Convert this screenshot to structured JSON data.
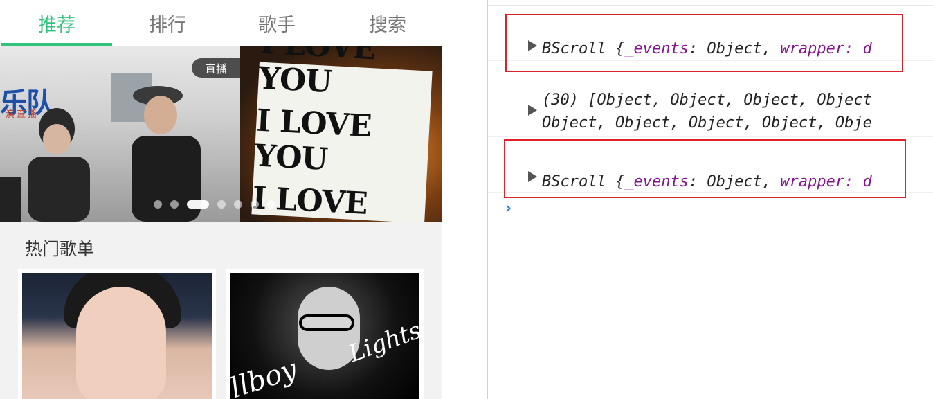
{
  "tabs": [
    {
      "label": "推荐",
      "active": true
    },
    {
      "label": "排行",
      "active": false
    },
    {
      "label": "歌手",
      "active": false
    },
    {
      "label": "搜索",
      "active": false
    }
  ],
  "slider": {
    "live_badge": "直播",
    "band_text": "乐队",
    "band_sub": "演直播",
    "sign_lines": [
      "I LOVE YOU",
      "I LOVE YOU",
      "I LOVE YOU"
    ],
    "dot_count": 7,
    "active_dot": 3
  },
  "section": {
    "title": "热门歌单"
  },
  "cards": [
    {
      "image": "portrait-woman"
    },
    {
      "image": "portrait-man-glasses",
      "script_text": "llboy",
      "script_text_2": "Lights"
    }
  ],
  "console": {
    "rows": [
      {
        "parts": [
          {
            "t": "BScroll {",
            "k": false
          },
          {
            "t": "_events",
            "k": true
          },
          {
            "t": ": Object, ",
            "k": false
          },
          {
            "t": "wrapper",
            "k": true
          },
          {
            "t": ": d",
            "k": false
          }
        ]
      },
      {
        "line1": "(30) [Object, Object, Object, Object",
        "line2": "Object, Object, Object, Object, Obje"
      },
      {
        "parts": [
          {
            "t": "BScroll {",
            "k": false
          },
          {
            "t": "_events",
            "k": true
          },
          {
            "t": ": Object, ",
            "k": false
          },
          {
            "t": "wrapper",
            "k": true
          },
          {
            "t": ": d",
            "k": false
          }
        ]
      }
    ],
    "prompt": "›"
  },
  "colors": {
    "accent": "#31c27c",
    "highlight": "#e0202a",
    "console_key": "#881391"
  }
}
